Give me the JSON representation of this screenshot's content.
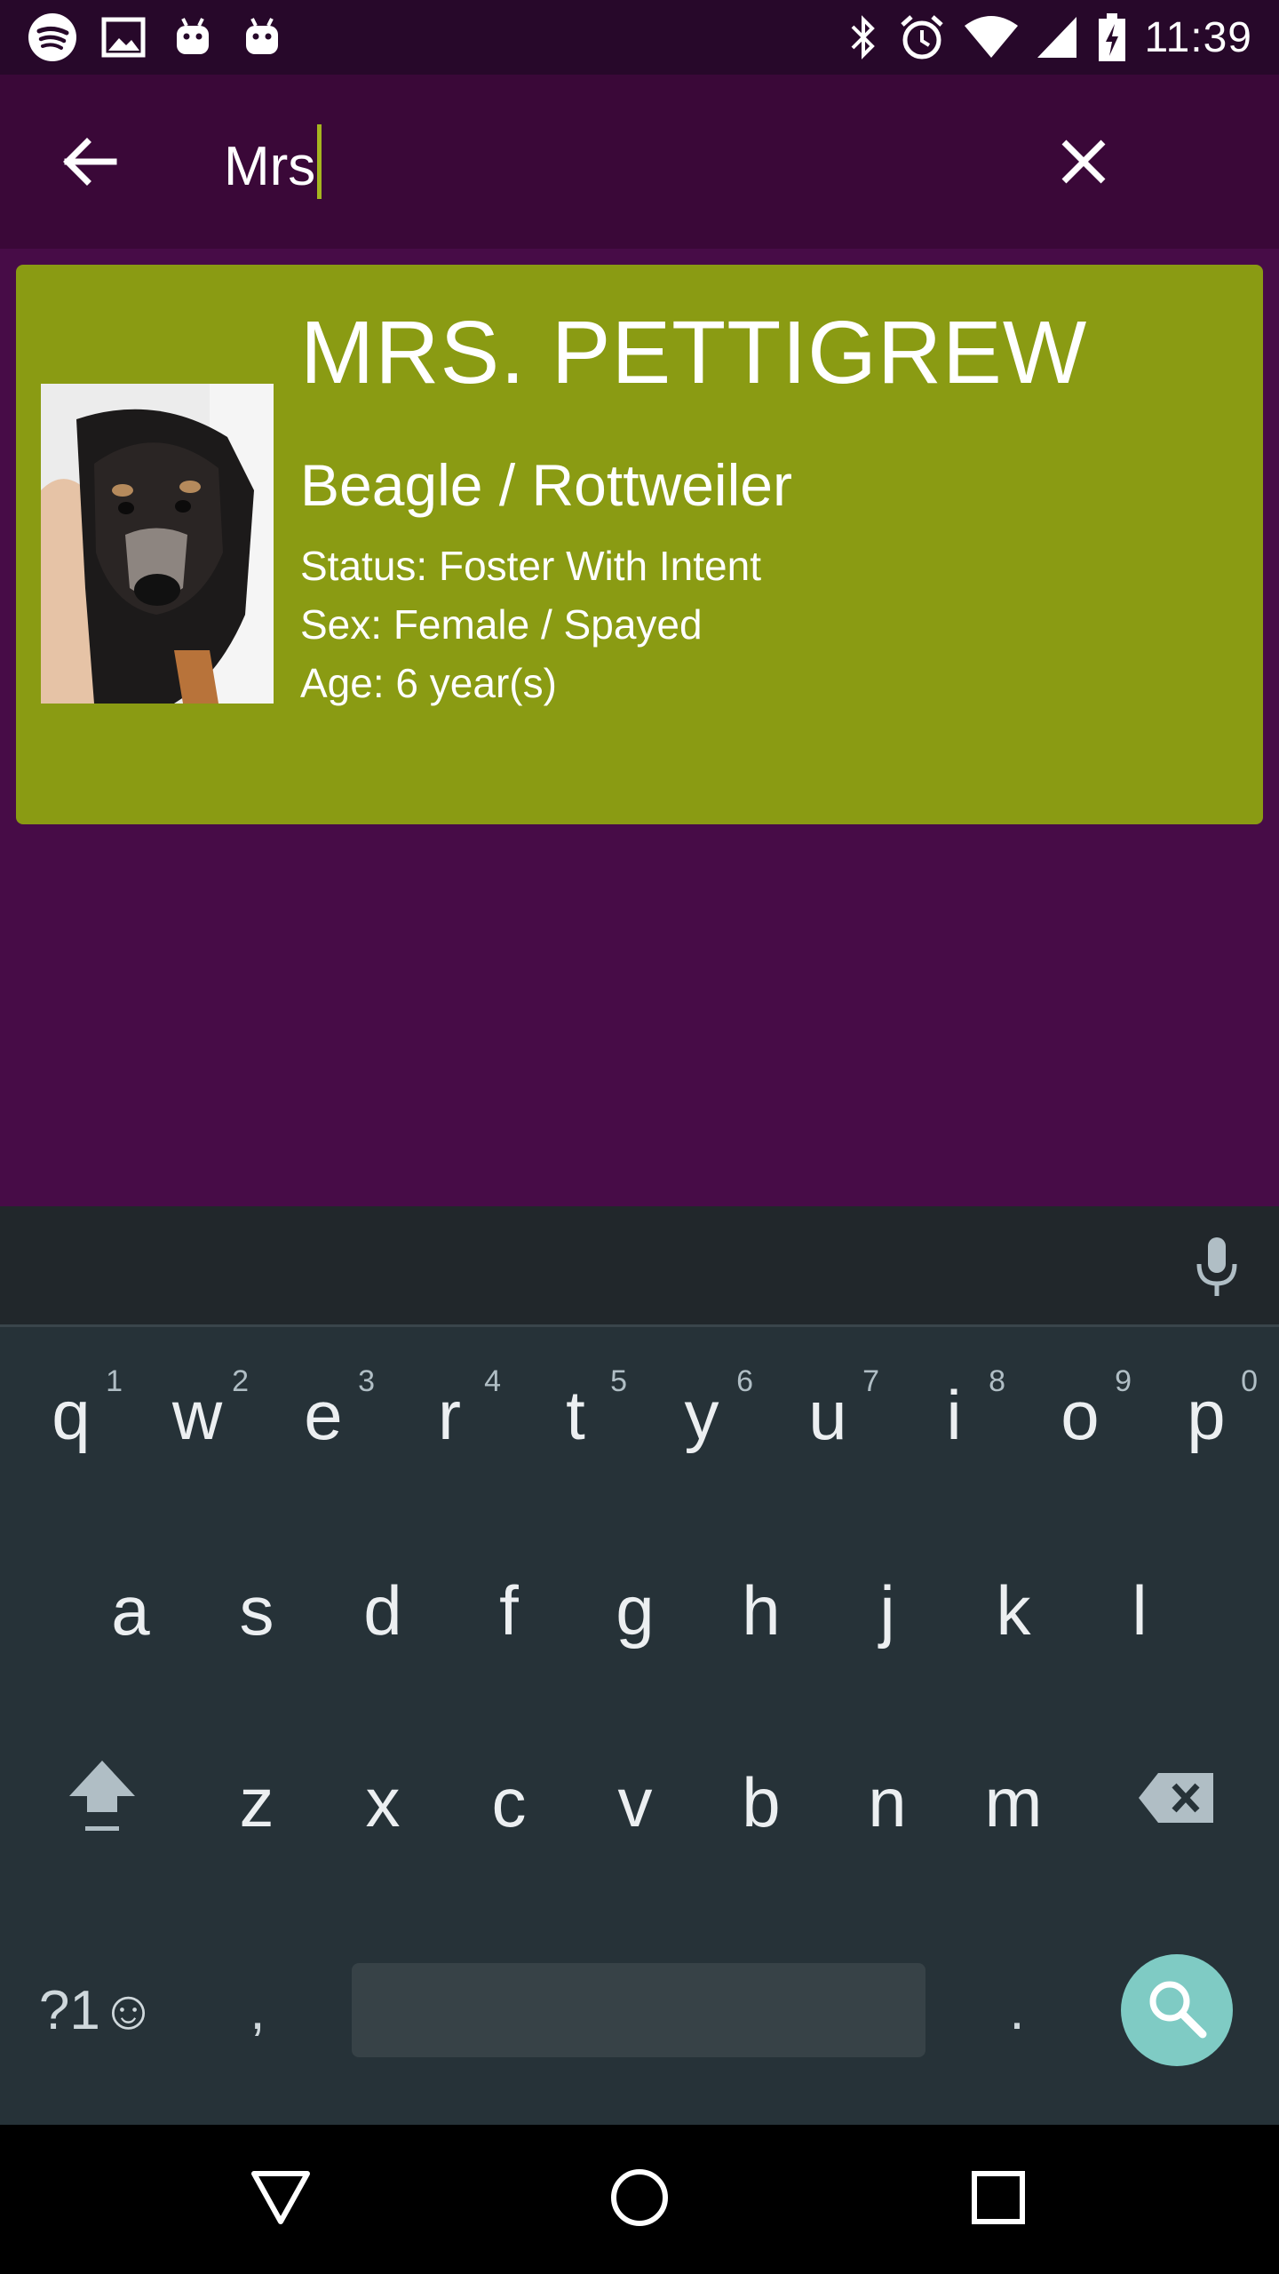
{
  "status_bar": {
    "time": "11:39",
    "left_icons": [
      "spotify-icon",
      "image-icon",
      "android-icon",
      "android-icon"
    ],
    "right_icons": [
      "bluetooth-icon",
      "alarm-icon",
      "wifi-icon",
      "signal-icon",
      "battery-charging-icon"
    ]
  },
  "app_bar": {
    "back_icon": "arrow-back-icon",
    "search_value": "Mrs",
    "clear_icon": "close-icon",
    "background": "#3a0838"
  },
  "result_card": {
    "background": "#8a9b13",
    "name": "MRS. PETTIGREW",
    "breed": "Beagle / Rottweiler",
    "status": "Status: Foster With Intent",
    "sex": "Sex: Female / Spayed",
    "age": "Age: 6 year(s)"
  },
  "keyboard": {
    "row1": [
      {
        "label": "q",
        "hint": "1"
      },
      {
        "label": "w",
        "hint": "2"
      },
      {
        "label": "e",
        "hint": "3"
      },
      {
        "label": "r",
        "hint": "4"
      },
      {
        "label": "t",
        "hint": "5"
      },
      {
        "label": "y",
        "hint": "6"
      },
      {
        "label": "u",
        "hint": "7"
      },
      {
        "label": "i",
        "hint": "8"
      },
      {
        "label": "o",
        "hint": "9"
      },
      {
        "label": "p",
        "hint": "0"
      }
    ],
    "row2": [
      "a",
      "s",
      "d",
      "f",
      "g",
      "h",
      "j",
      "k",
      "l"
    ],
    "row3": [
      "z",
      "x",
      "c",
      "v",
      "b",
      "n",
      "m"
    ],
    "symbols_label": "?1☺",
    "comma_label": ",",
    "period_label": ".",
    "accent_color": "#7fcbc4"
  },
  "nav_bar": {
    "icons": [
      "back-triangle-icon",
      "home-circle-icon",
      "recents-square-icon"
    ]
  }
}
